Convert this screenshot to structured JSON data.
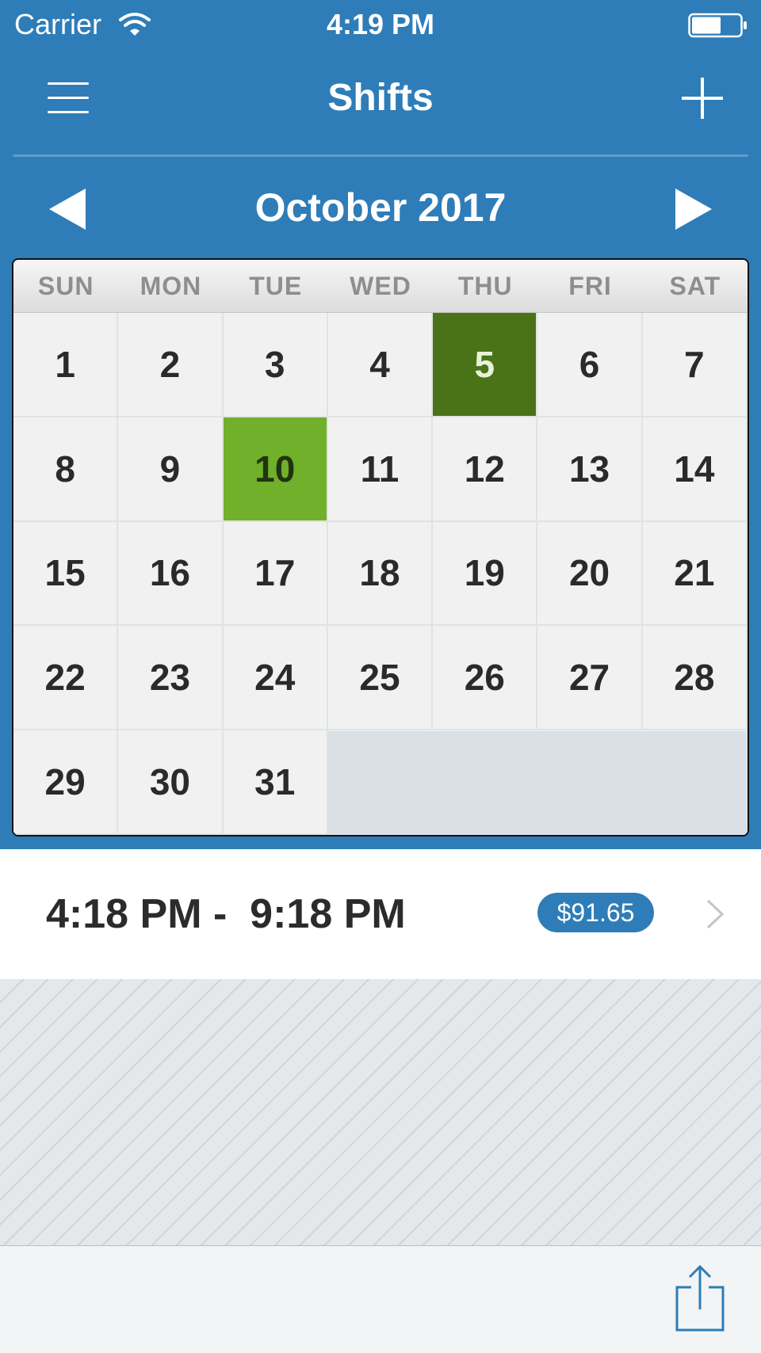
{
  "status_bar": {
    "carrier": "Carrier",
    "time": "4:19 PM"
  },
  "nav": {
    "title": "Shifts",
    "left_icon": "menu-icon",
    "right_icon": "add-icon"
  },
  "calendar": {
    "month_label": "October 2017",
    "weekdays": [
      "SUN",
      "MON",
      "TUE",
      "WED",
      "THU",
      "FRI",
      "SAT"
    ],
    "days": [
      "1",
      "2",
      "3",
      "4",
      "5",
      "6",
      "7",
      "8",
      "9",
      "10",
      "11",
      "12",
      "13",
      "14",
      "15",
      "16",
      "17",
      "18",
      "19",
      "20",
      "21",
      "22",
      "23",
      "24",
      "25",
      "26",
      "27",
      "28",
      "29",
      "30",
      "31"
    ],
    "today_day": "5",
    "selected_day": "10",
    "first_weekday_index": 0
  },
  "shift": {
    "time_range": "4:18 PM -  9:18 PM",
    "pay": "$91.65"
  },
  "toolbar": {
    "share_icon": "share-icon"
  },
  "colors": {
    "header_blue": "#2e7db8",
    "today_green": "#4a7318",
    "selected_green": "#71b02a"
  }
}
